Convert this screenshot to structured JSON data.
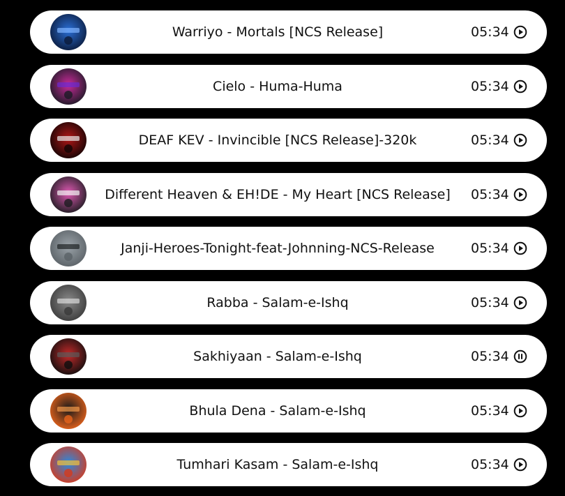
{
  "songs": [
    {
      "title": "Warriyo - Mortals [NCS Release]",
      "duration": "05:34",
      "state": "play",
      "cover_icon": "album-cover-warriyo-mortals",
      "colors": [
        "#0b1a3a",
        "#2a6fd6",
        "#7fb4ff"
      ]
    },
    {
      "title": "Cielo - Huma-Huma",
      "duration": "05:34",
      "state": "play",
      "cover_icon": "album-cover-cielo-huma-huma",
      "colors": [
        "#1a1a24",
        "#c92a9a",
        "#6a2ad0"
      ]
    },
    {
      "title": "DEAF KEV - Invincible [NCS Release]-320k",
      "duration": "05:34",
      "state": "play",
      "cover_icon": "album-cover-deaf-kev-invincible",
      "colors": [
        "#120404",
        "#b01616",
        "#e8e8e8"
      ]
    },
    {
      "title": "Different Heaven & EH!DE - My Heart [NCS Release]",
      "duration": "05:34",
      "state": "play",
      "cover_icon": "album-cover-different-heaven-my-heart",
      "colors": [
        "#1b1b1f",
        "#e05ab4",
        "#f2f2f2"
      ]
    },
    {
      "title": "Janji-Heroes-Tonight-feat-Johnning-NCS-Release",
      "duration": "05:34",
      "state": "play",
      "cover_icon": "album-cover-janji-heroes-tonight",
      "colors": [
        "#5a6166",
        "#9aa2a8",
        "#1e2224"
      ]
    },
    {
      "title": "Rabba - Salam-e-Ishq",
      "duration": "05:34",
      "state": "play",
      "cover_icon": "album-cover-rabba",
      "colors": [
        "#3a3a3a",
        "#8a8a8a",
        "#d8d8d8"
      ]
    },
    {
      "title": "Sakhiyaan - Salam-e-Ishq",
      "duration": "05:34",
      "state": "pause",
      "cover_icon": "album-cover-sakhiyaan",
      "colors": [
        "#0e0e0e",
        "#c42a2a",
        "#5a5a5a"
      ]
    },
    {
      "title": "Bhula Dena - Salam-e-Ishq",
      "duration": "05:34",
      "state": "play",
      "cover_icon": "album-cover-bhula-dena",
      "colors": [
        "#e8641c",
        "#1a1a1a",
        "#f39a4a"
      ]
    },
    {
      "title": "Tumhari Kasam - Salam-e-Ishq",
      "duration": "05:34",
      "state": "play",
      "cover_icon": "album-cover-tumhari-kasam",
      "colors": [
        "#d63a1c",
        "#2a8ae0",
        "#f2c23a"
      ]
    }
  ]
}
